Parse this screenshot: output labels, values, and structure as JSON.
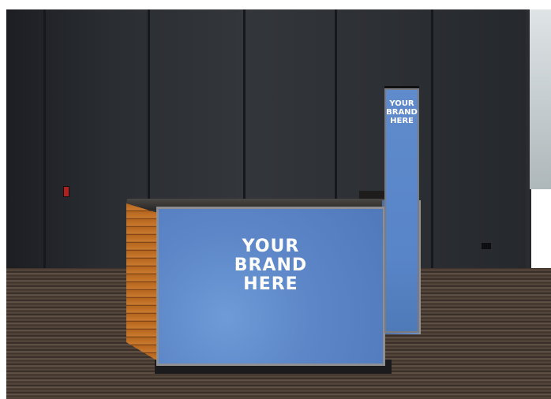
{
  "scene": {
    "front_panel_text": [
      "YOUR",
      "BRAND",
      "HERE"
    ],
    "tower_text": [
      "YOUR",
      "BRAND",
      "HERE"
    ]
  },
  "colors": {
    "panel_blue": "#5c86c7",
    "wall": "#2d3035",
    "wood": "#b5651d"
  }
}
